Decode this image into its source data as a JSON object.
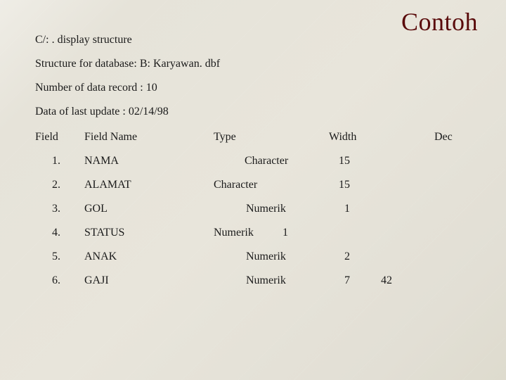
{
  "title": "Contoh",
  "lines": {
    "cmd": "C/: . display structure",
    "db": "Structure for database: B: Karyawan. dbf",
    "count": "Number of data record : 10",
    "updated": "Data of last update : 02/14/98"
  },
  "headers": {
    "field": "Field",
    "name": "Field Name",
    "type": "Type",
    "width": "Width",
    "dec": "Dec"
  },
  "rows": [
    {
      "num": "1.",
      "name": "NAMA",
      "type": "Character",
      "width": "15",
      "dec": ""
    },
    {
      "num": "2.",
      "name": "ALAMAT",
      "type": "Character",
      "width": "15",
      "dec": ""
    },
    {
      "num": "3.",
      "name": "GOL",
      "type": "Numerik",
      "width": "1",
      "dec": ""
    },
    {
      "num": "4.",
      "name": "STATUS",
      "type": "Numerik",
      "width": "1",
      "dec": ""
    },
    {
      "num": "5.",
      "name": "ANAK",
      "type": "Numerik",
      "width": "2",
      "dec": ""
    },
    {
      "num": "6.",
      "name": "GAJI",
      "type": "Numerik",
      "width": "7",
      "dec": "42"
    }
  ]
}
